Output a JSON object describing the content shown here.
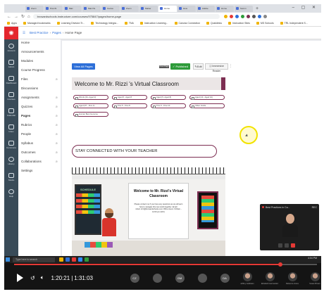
{
  "browser": {
    "tabs": [
      "Zoom",
      "Ponchi",
      "Mac",
      "Mac Pa",
      "Canva",
      "Zoom",
      "Matter",
      "Home",
      "How",
      "Adobe",
      "Home",
      "Summ"
    ],
    "url": "browardschools.instructure.com/courses/975847/pages/home-page",
    "bookmarks": [
      "Apps",
      "Managed bookmarks",
      "Learning Division Tr...",
      "Technology Integra...",
      "TNA",
      "Instruction Learning...",
      "Canvas Connection",
      "Quicklinks",
      "Instruction Sites",
      "MS Schools",
      "TRL Independent S..."
    ]
  },
  "global_nav": {
    "items": [
      "Account",
      "Admin",
      "Dashboard",
      "Courses",
      "Calendar",
      "Inbox",
      "Commons",
      "History",
      "Studio",
      "Help"
    ]
  },
  "breadcrumb": {
    "course": "Best Practice",
    "section": "Pages",
    "page": "Home Page"
  },
  "course_nav": {
    "items": [
      "Home",
      "Announcements",
      "Modules",
      "Course Progress",
      "Files",
      "Discussions",
      "Assignments",
      "Quizzes",
      "Pages",
      "Rubrics",
      "People",
      "Syllabus",
      "Outcomes",
      "Collaborations",
      "Settings"
    ]
  },
  "toolbar": {
    "view_all": "View All Pages",
    "front": "Front Page",
    "published": "Published",
    "edit": "Edit",
    "immersive": "Immersive Reader"
  },
  "page": {
    "welcome": "Welcome to Mr. Rizzi 's Virtual Classroom",
    "buttons": [
      "Words (01- Aged 2)",
      "Aged 8 - Aged 8",
      "Aged (5- Aged 8)",
      "Aged (10 - Aged 10)",
      "Aged (07 - Five 4)",
      "Five 5 - Five 8",
      "Five 9 - Five 10",
      "Video Guide",
      "Human Best Genome"
    ],
    "stay": "STAY CONNECTED WITH YOUR TEACHER",
    "schedule": "SCHEDULE",
    "board_title": "Welcome to Mr. Rizzi's Virtual Classroom",
    "board_text": "Please contact me if you have any questions as we all learn how to navigate this new world together. Email: robert.rizzi@browardschools.com Office Hours: 9:00am - 12:00 pm (M-F)"
  },
  "zoom_popup": {
    "title": "Best Practices in Ca...",
    "status": "REC"
  },
  "taskbar": {
    "search": "Type here to search",
    "clock": "4:04 PM"
  },
  "player": {
    "current": "1:20:21",
    "total": "1:31:03",
    "progress": 0.88,
    "participants": [
      {
        "initials": "CZ",
        "name": ""
      },
      {
        "initials": "",
        "name": ""
      },
      {
        "initials": "GM",
        "name": ""
      },
      {
        "initials": "",
        "name": ""
      },
      {
        "initials": "DA",
        "name": ""
      },
      {
        "initials": "",
        "name": "Jeffrey Goldstein"
      },
      {
        "initials": "",
        "name": "Elizabeth Hernandez"
      },
      {
        "initials": "",
        "name": "Rebecca Jones"
      },
      {
        "initials": "",
        "name": "Susan Brown"
      }
    ]
  },
  "colors": {
    "canvas_nav": "#394b58",
    "brand_red": "#e4262d",
    "accent_maroon": "#7d2e52",
    "published_green": "#2e9b3a",
    "link_blue": "#2d6fd8",
    "cursor_highlight": "#f2e300",
    "progress_red": "#e53935"
  }
}
